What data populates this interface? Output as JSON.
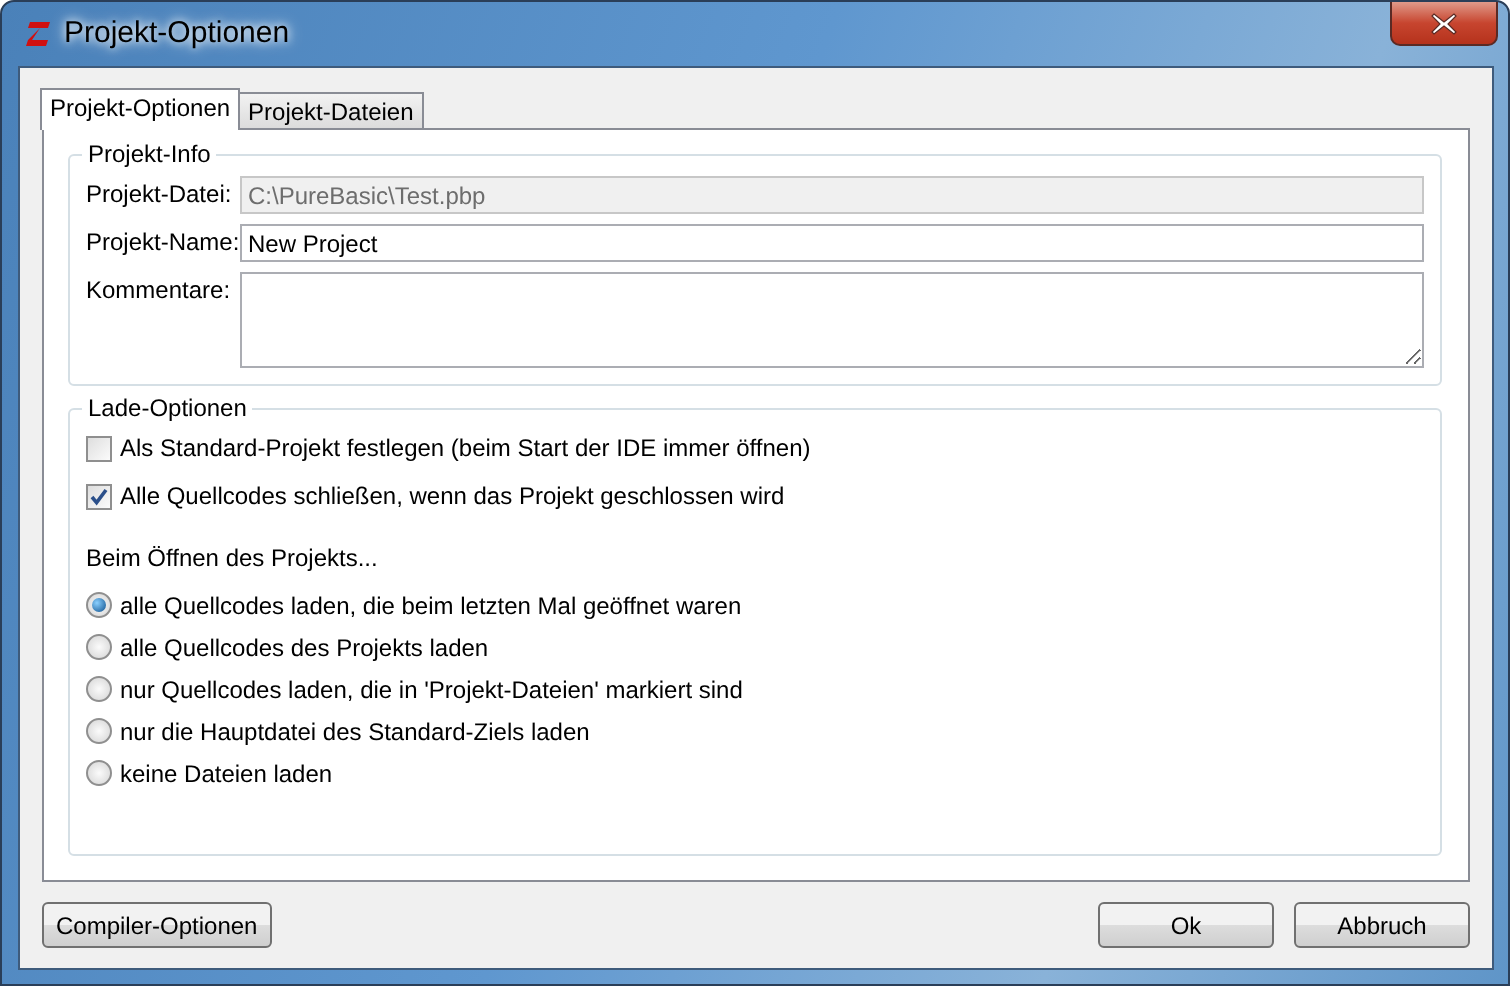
{
  "window": {
    "title": "Projekt-Optionen"
  },
  "tabs": [
    {
      "label": "Projekt-Optionen",
      "selected": true
    },
    {
      "label": "Projekt-Dateien",
      "selected": false
    }
  ],
  "project_info": {
    "legend": "Projekt-Info",
    "fields": [
      {
        "label": "Projekt-Datei:",
        "value": "C:\\PureBasic\\Test.pbp",
        "disabled": true,
        "kind": "line"
      },
      {
        "label": "Projekt-Name:",
        "value": "New Project",
        "disabled": false,
        "kind": "line"
      },
      {
        "label": "Kommentare:",
        "disabled": false,
        "kind": "multiline"
      }
    ]
  },
  "load_options": {
    "legend": "Lade-Optionen",
    "checkboxes": [
      {
        "label": "Als Standard-Projekt festlegen (beim Start der IDE immer öffnen)",
        "checked": false
      },
      {
        "label": "Alle Quellcodes schließen, wenn das Projekt geschlossen wird",
        "checked": true
      }
    ],
    "radio_heading": "Beim Öffnen des Projekts...",
    "radios": [
      {
        "label": "alle Quellcodes laden, die beim letzten Mal geöffnet waren",
        "selected": true
      },
      {
        "label": "alle Quellcodes des Projekts laden",
        "selected": false
      },
      {
        "label": "nur Quellcodes laden, die in 'Projekt-Dateien' markiert sind",
        "selected": false
      },
      {
        "label": "nur die Hauptdatei des Standard-Ziels laden",
        "selected": false
      },
      {
        "label": "keine Dateien laden",
        "selected": false
      }
    ]
  },
  "buttons": {
    "left": [
      {
        "label": "Compiler-Optionen"
      }
    ],
    "right": [
      {
        "label": "Ok"
      },
      {
        "label": "Abbruch"
      }
    ]
  }
}
